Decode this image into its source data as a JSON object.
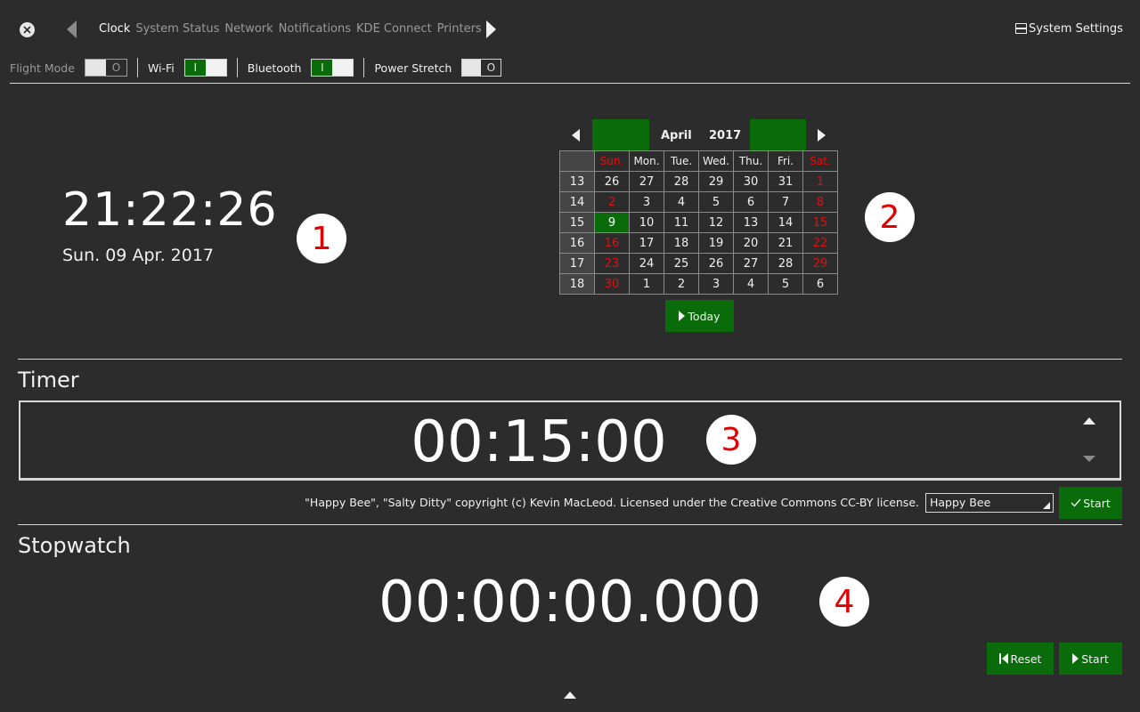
{
  "topbar": {
    "tabs": [
      "Clock",
      "System Status",
      "Network",
      "Notifications",
      "KDE Connect",
      "Printers"
    ],
    "active_tab": "Clock",
    "system_settings_label": "System Settings"
  },
  "quick_toggles": {
    "flight_mode": {
      "label": "Flight Mode",
      "state": "O"
    },
    "wifi": {
      "label": "Wi-Fi",
      "state": "I"
    },
    "bluetooth": {
      "label": "Bluetooth",
      "state": "I"
    },
    "power_stretch": {
      "label": "Power Stretch",
      "state": "O"
    }
  },
  "clock": {
    "time": "21:22:26",
    "date": "Sun. 09 Apr. 2017",
    "badge": "1"
  },
  "calendar": {
    "month": "April",
    "year": "2017",
    "badge": "2",
    "weekdays": [
      "Sun.",
      "Mon.",
      "Tue.",
      "Wed.",
      "Thu.",
      "Fri.",
      "Sat."
    ],
    "weeks": [
      {
        "num": "13",
        "days": [
          "26",
          "27",
          "28",
          "29",
          "30",
          "31",
          "1"
        ]
      },
      {
        "num": "14",
        "days": [
          "2",
          "3",
          "4",
          "5",
          "6",
          "7",
          "8"
        ]
      },
      {
        "num": "15",
        "days": [
          "9",
          "10",
          "11",
          "12",
          "13",
          "14",
          "15"
        ]
      },
      {
        "num": "16",
        "days": [
          "16",
          "17",
          "18",
          "19",
          "20",
          "21",
          "22"
        ]
      },
      {
        "num": "17",
        "days": [
          "23",
          "24",
          "25",
          "26",
          "27",
          "28",
          "29"
        ]
      },
      {
        "num": "18",
        "days": [
          "30",
          "1",
          "2",
          "3",
          "4",
          "5",
          "6"
        ]
      }
    ],
    "selected_day": "9",
    "today_label": "Today",
    "colors": {
      "weekend": "#e01010",
      "selected": "#0a6b0a"
    }
  },
  "timer": {
    "title": "Timer",
    "value": "00:15:00",
    "badge": "3",
    "credit": "\"Happy Bee\", \"Salty Ditty\" copyright (c) Kevin MacLeod. Licensed under the Creative Commons CC-BY license.",
    "song": "Happy Bee",
    "start_label": "Start"
  },
  "stopwatch": {
    "title": "Stopwatch",
    "value": "00:00:00.000",
    "badge": "4",
    "reset_label": "Reset",
    "start_label": "Start"
  },
  "icons": [
    "close-icon",
    "arrow-left-icon",
    "arrow-right-icon",
    "settings-icon",
    "play-icon",
    "check-icon",
    "rewind-icon",
    "arrow-up-icon",
    "arrow-down-icon"
  ],
  "colors": {
    "background": "#2c2c2c",
    "accent": "#0a6b0a",
    "badge_text": "#e00000"
  }
}
